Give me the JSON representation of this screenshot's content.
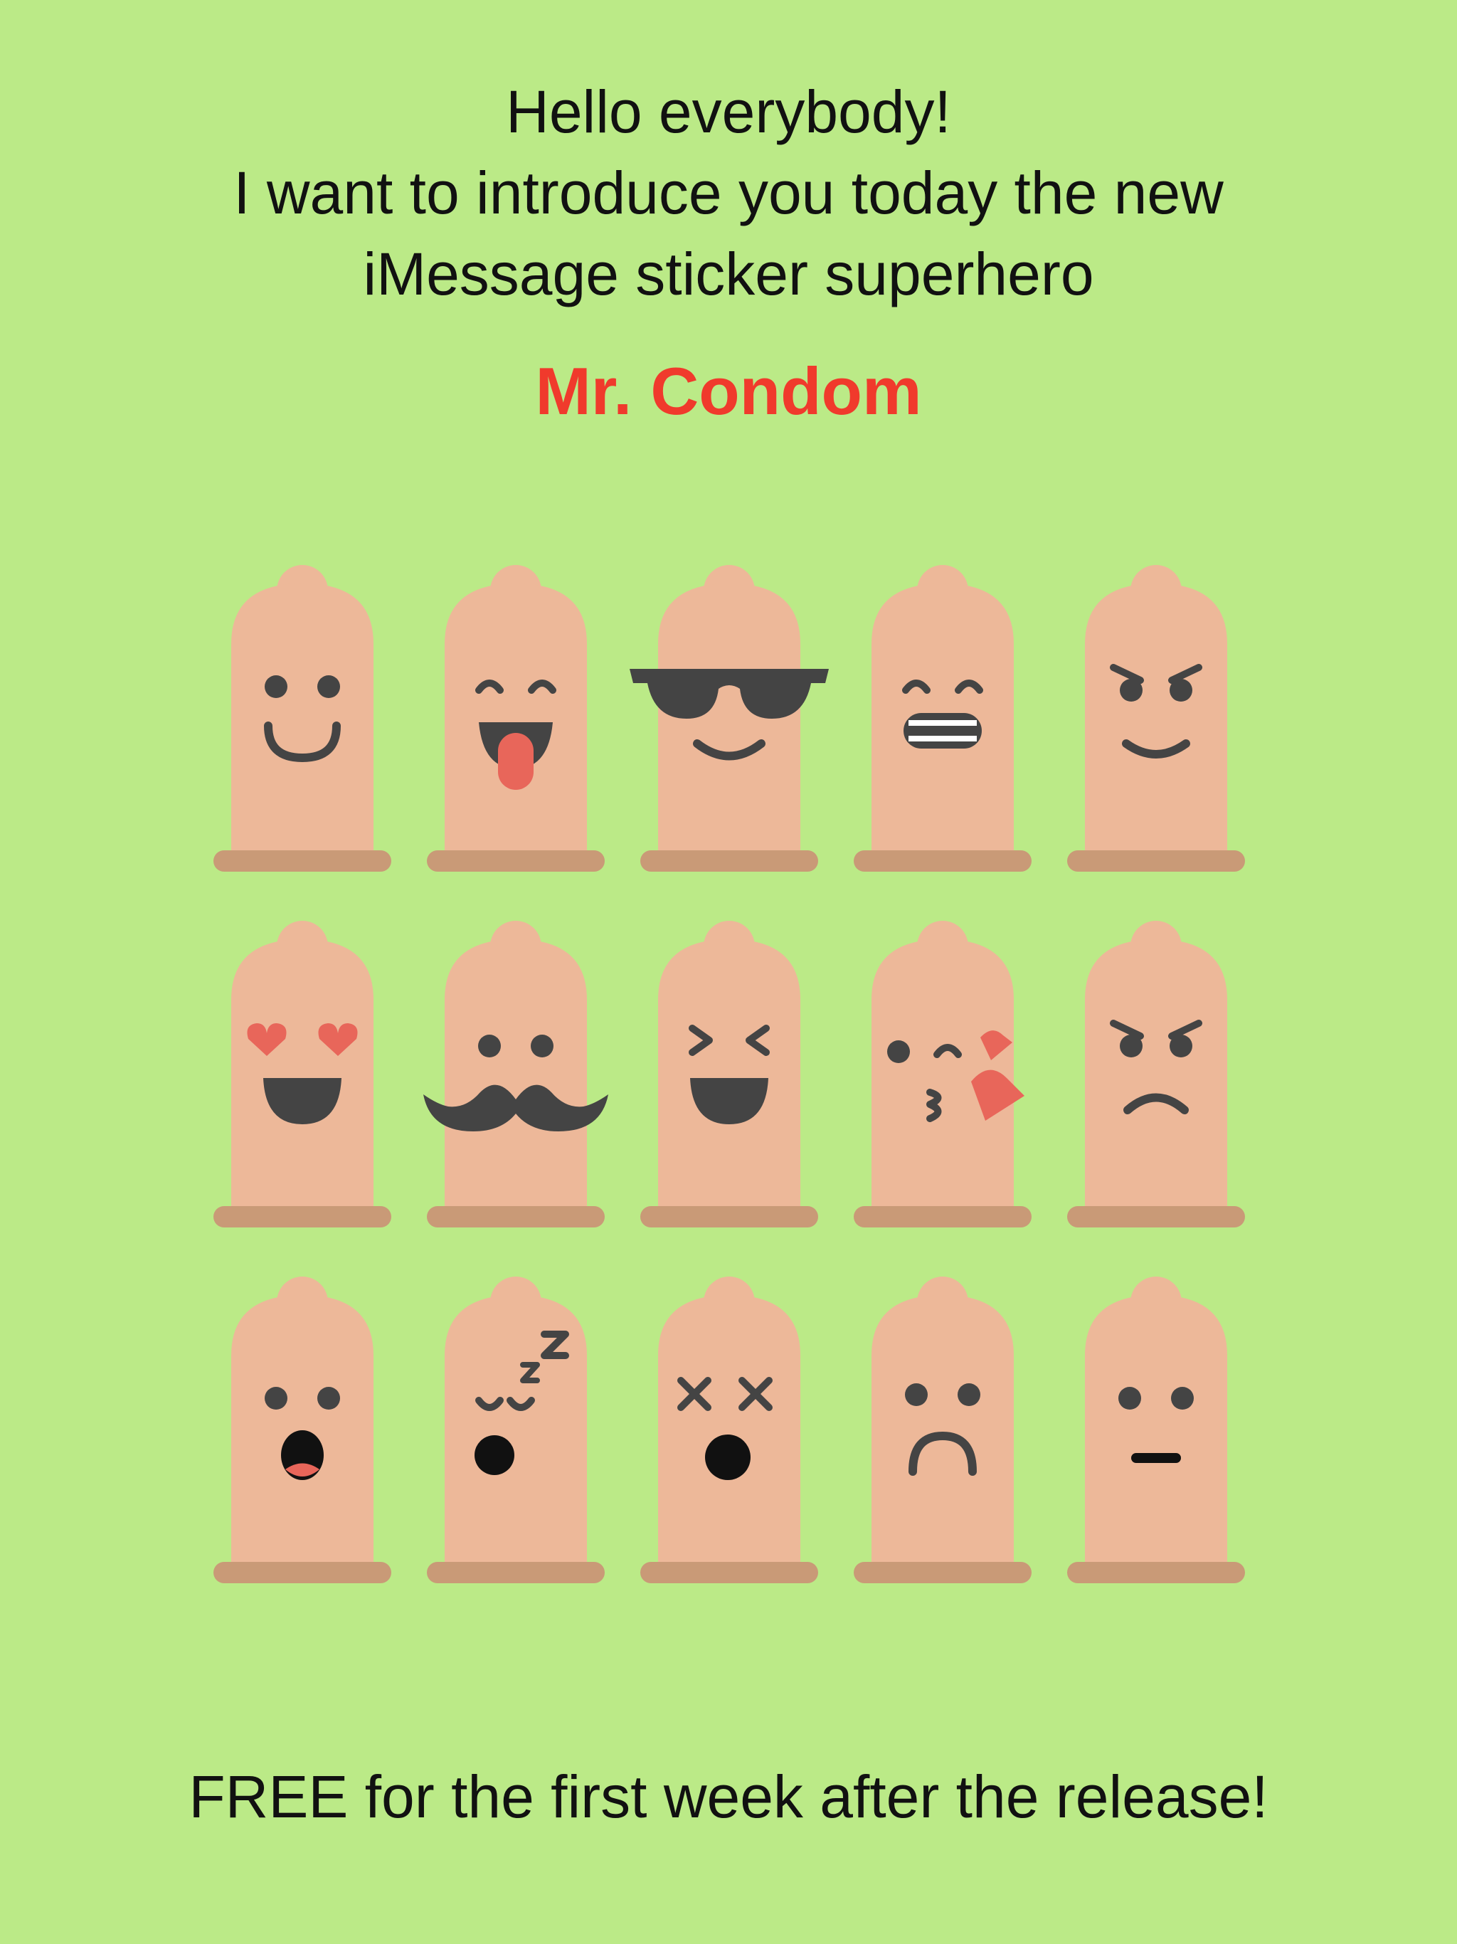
{
  "intro": {
    "line1": "Hello everybody!",
    "line2": "I want to introduce you today the new",
    "line3": "iMessage sticker superhero"
  },
  "title": "Mr. Condom",
  "footer": "FREE for the first week after the release!",
  "colors": {
    "background": "#bbea87",
    "title": "#f03a2c",
    "body": "#edb899",
    "rim": "#c99a77",
    "face": "#444444",
    "accent": "#e8665a"
  },
  "stickers": [
    {
      "icon": "smiling-condom-sticker-icon"
    },
    {
      "icon": "tongue-out-condom-sticker-icon"
    },
    {
      "icon": "sunglasses-condom-sticker-icon"
    },
    {
      "icon": "grimacing-condom-sticker-icon"
    },
    {
      "icon": "smirking-condom-sticker-icon"
    },
    {
      "icon": "heart-eyes-condom-sticker-icon"
    },
    {
      "icon": "mustache-condom-sticker-icon"
    },
    {
      "icon": "laughing-condom-sticker-icon"
    },
    {
      "icon": "kissing-condom-sticker-icon"
    },
    {
      "icon": "angry-condom-sticker-icon"
    },
    {
      "icon": "surprised-condom-sticker-icon"
    },
    {
      "icon": "sleeping-condom-sticker-icon"
    },
    {
      "icon": "dizzy-condom-sticker-icon"
    },
    {
      "icon": "frowning-condom-sticker-icon"
    },
    {
      "icon": "neutral-condom-sticker-icon"
    }
  ]
}
